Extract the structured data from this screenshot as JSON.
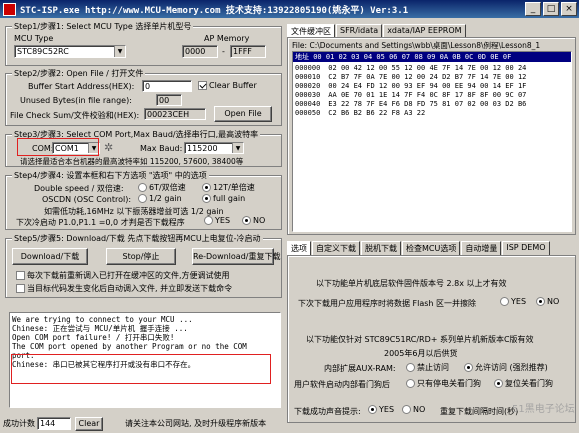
{
  "window": {
    "title": "STC-ISP.exe  http://www.MCU-Memory.com 技术支持:13922805190(姚永平) Ver:3.1",
    "buttons": [
      "_",
      "□",
      "×"
    ]
  },
  "step1": {
    "legend": "Step1/步骤1: Select MCU Type  选择单片机型号",
    "mcu_type_label": "MCU Type",
    "ap_memory_label": "AP Memory",
    "mcu_selected": "STC89C52RC",
    "ap_start": "0000",
    "ap_dash": "-",
    "ap_end": "1FFF"
  },
  "step2": {
    "legend": "Step2/步骤2: Open File / 打开文件",
    "buffer_label": "Buffer Start Address(HEX):",
    "buffer_value": "0",
    "clear_buffer_label": "Clear Buffer",
    "clear_buffer_checked": true,
    "unused_label": "Unused Bytes(in file range):",
    "unused_value": "00",
    "checksum_label": "File Check Sum/文件校验和(HEX):",
    "checksum_value": "00023CEH",
    "open_file_button": "Open File"
  },
  "step3": {
    "legend": "Step3/步骤3: Select COM Port,Max Baud/选择串行口,最高波特率",
    "com_label": "COM:",
    "com_value": "COM1",
    "max_baud_label": "Max Baud:",
    "max_baud_value": "115200",
    "hint": "请选择最适合本台机器的最高波特率如 115200, 57600, 38400等"
  },
  "step4": {
    "legend": "Step4/步骤4: 设置本框和右下方选项 \"选项\" 中的选项",
    "double_speed_label": "Double speed / 双倍速:",
    "double_6t": "6T/双倍速",
    "double_12t": "12T/单倍速",
    "oscdn_label": "OSCDN (OSC Control):",
    "osc_half": "1/2 gain",
    "osc_full": "full gain",
    "osc_note": "如需低功耗,16MHz 以下振荡器增益可选 1/2 gain",
    "download_label": "下次冷启动 P1.0,P1.1 =0,0 才判是否下载程序",
    "yes": "YES",
    "no": "NO"
  },
  "step5": {
    "legend": "Step5/步骤5: Download/下载  先点下载按钮再MCU上电复位-冷启动",
    "download_button": "Download/下载",
    "stop_button": "Stop/停止",
    "redownload_button": "Re-Download/重复下载",
    "check1": "每次下载前重新调入已打开在缓冲区的文件,方便调试使用",
    "check2": "当目标代码发生变化后自动调入文件,  并立即发送下载命令"
  },
  "log": {
    "lines": [
      "We are trying to connect to your MCU ...",
      "Chinese: 正在尝试与 MCU/单片机 握手连接 ...",
      "Open COM port failure! / 打开串口失败!",
      "The COM port opened by another Program or no the COM",
      "port.",
      "Chinese: 串口已被其它程序打开或没有串口不存在。"
    ]
  },
  "statusbar": {
    "count_label": "成功计数",
    "count_value": "144",
    "clear_button": "Clear",
    "notice": "请关注本公司网站, 及时升级程序新版本"
  },
  "hexview": {
    "tabs": [
      "文件缓冲区",
      "SFR/idata",
      "xdata/IAP EEPROM"
    ],
    "active_tab": 0,
    "file_path": "File: C:\\Documents and Settings\\wbb\\桌面\\Lesson8\\例程\\Lesson8_1",
    "header": "地址  00 01 02 03 04 05 06 07 08 09 0A 0B 0C 0D 0E 0F",
    "rows": [
      {
        "addr": "000000",
        "bytes": "02 00 42 12 00 55 12 00 4E 7F 14 7E 00 12 00 24"
      },
      {
        "addr": "000010",
        "bytes": "C2 B7 7F 0A 7E 00 12 00 24 D2 B7 7F 14 7E 00 12"
      },
      {
        "addr": "000020",
        "bytes": "00 24 E4 FD 12 00 93 EF 94 00 EE 94 00 14 EF 1F"
      },
      {
        "addr": "000030",
        "bytes": "AA 0E 70 01 1E 14 7F F4 0C 8F 17 8F 8F 00 9C 07"
      },
      {
        "addr": "000040",
        "bytes": "E3 22 78 7F E4 F6 D8 FD 75 81 07 02 00 03 D2 B6"
      },
      {
        "addr": "000050",
        "bytes": "C2 B6 B2 B6 22 F8 A3 22"
      }
    ]
  },
  "options": {
    "tabs": [
      "选项",
      "自定义下载",
      "脱机下载",
      "检查MCU选项",
      "自动增量",
      "ISP DEMO"
    ],
    "active_tab": 0,
    "text1": "以下功能单片机底层软件固件版本号 2.8x 以上才有效",
    "text2": "下次下载用户应用程序时将数据  Flash 区一并擦除",
    "yes": "YES",
    "no": "NO",
    "text3": "以下功能仅针对  STC89C51RC/RD+ 系列单片机新版本C版有效",
    "text4": "2005年6月以后供货",
    "aux_label": "内部扩展AUX-RAM:",
    "aux_opt1": "禁止访问",
    "aux_opt2": "允许访问 (强烈推荐)",
    "reset_label": "用户软件启动内部看门狗后",
    "reset_opt1": "只有停电关看门狗",
    "reset_opt2": "复位关看门狗",
    "sound_label": "下载成功声音提示:",
    "sound_yes": "YES",
    "sound_no": "NO",
    "repeat_label": "重复下载间隔时间(秒)",
    "watermark": "51黑电子论坛"
  },
  "accent": {
    "titlebar": "#0a246a",
    "annotation_red": "#e02020",
    "hex_header_bg": "#000080"
  }
}
